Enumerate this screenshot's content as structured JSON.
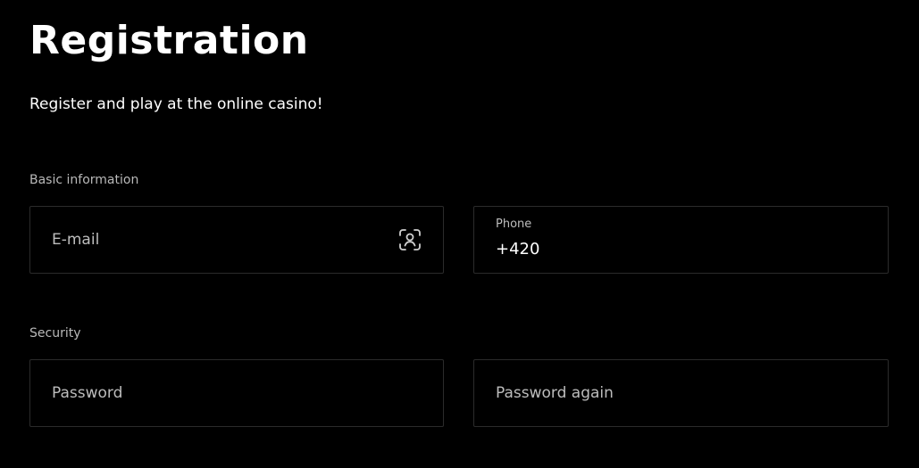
{
  "header": {
    "title": "Registration",
    "subtitle": "Register and play at the online casino!"
  },
  "sections": {
    "basic": {
      "label": "Basic information",
      "email": {
        "placeholder": "E-mail",
        "icon": "face-id-icon"
      },
      "phone": {
        "label": "Phone",
        "value": "+420"
      }
    },
    "security": {
      "label": "Security",
      "password": {
        "placeholder": "Password"
      },
      "password_again": {
        "placeholder": "Password again"
      }
    }
  },
  "colors": {
    "background": "#000000",
    "border": "#2b2b2b",
    "placeholder": "#bdbdbd",
    "text": "#ffffff"
  }
}
